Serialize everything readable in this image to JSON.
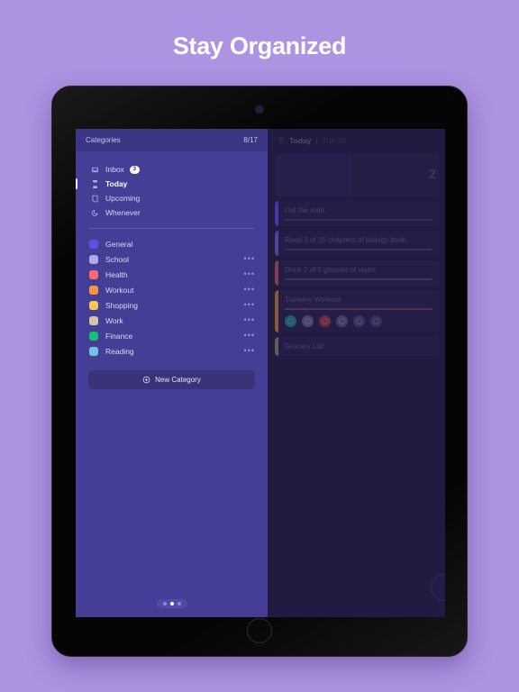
{
  "headline": "Stay Organized",
  "colors": {
    "background": "#ae93e3",
    "sidebar": "#443e96",
    "sidebar_header": "#3c3785",
    "panel": "#2a2350",
    "accent": "#ffffff"
  },
  "sidebar": {
    "header": {
      "title": "Categories",
      "count": "8/17"
    },
    "nav": [
      {
        "label": "Inbox",
        "icon": "inbox-icon",
        "badge": "3",
        "active": false
      },
      {
        "label": "Today",
        "icon": "hourglass-icon",
        "badge": "",
        "active": true
      },
      {
        "label": "Upcoming",
        "icon": "calendar-icon",
        "badge": "",
        "active": false
      },
      {
        "label": "Whenever",
        "icon": "moon-icon",
        "badge": "",
        "active": false
      }
    ],
    "categories": [
      {
        "label": "General",
        "color": "#5b50e8",
        "menu": ""
      },
      {
        "label": "School",
        "color": "#b0a6e8",
        "menu": "•••"
      },
      {
        "label": "Health",
        "color": "#fa6b7a",
        "menu": "•••"
      },
      {
        "label": "Workout",
        "color": "#f79640",
        "menu": "•••"
      },
      {
        "label": "Shopping",
        "color": "#fac45c",
        "menu": "•••"
      },
      {
        "label": "Work",
        "color": "#d3c3a8",
        "menu": "•••"
      },
      {
        "label": "Finance",
        "color": "#12c078",
        "menu": "•••"
      },
      {
        "label": "Reading",
        "color": "#6fc4e8",
        "menu": "•••"
      }
    ],
    "new_category": {
      "label": "New Category",
      "icon": "plus-circle-icon"
    },
    "pager": {
      "dots": 3,
      "active_index": 1
    }
  },
  "panel": {
    "icon": "list-icon",
    "title": "Today",
    "separator": "|",
    "date": "Tue 20",
    "hero_number": "2",
    "tasks": [
      {
        "title": "Get the mail.",
        "bar": "#5b50e8",
        "progress": false,
        "icons": []
      },
      {
        "title": "Read 2 of 25 chapters of biology book.",
        "bar": "#6a5fd0",
        "progress": true,
        "icons": []
      },
      {
        "title": "Drink 2 of 5 glasses of water.",
        "bar": "#b85563",
        "progress": true,
        "icons": []
      },
      {
        "title": "Tuesday Workout",
        "bar": "#c07a46",
        "progress": true,
        "icons": [
          "#2f7f86",
          "#6b5f8c",
          "#96384f",
          "#5d5480",
          "#4d4676",
          "#55406b"
        ]
      },
      {
        "title": "Grocery List",
        "bar": "#8d8070",
        "progress": false,
        "icons": []
      }
    ]
  }
}
